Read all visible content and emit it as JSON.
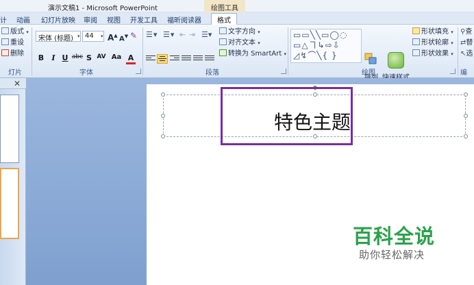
{
  "window": {
    "title": "演示文稿1 - Microsoft PowerPoint",
    "context_group": "绘图工具"
  },
  "tabs": [
    {
      "label": "计"
    },
    {
      "label": "动画"
    },
    {
      "label": "幻灯片放映"
    },
    {
      "label": "审阅"
    },
    {
      "label": "视图"
    },
    {
      "label": "开发工具"
    },
    {
      "label": "福昕阅读器"
    },
    {
      "label": "格式"
    }
  ],
  "ribbon": {
    "slides_group": {
      "label": "灯片",
      "layout": "版式",
      "reset": "重设",
      "delete": "删除"
    },
    "font_group": {
      "label": "字体",
      "font_name": "宋体 (标题)",
      "font_size": "44",
      "grow": "A",
      "shrink": "A",
      "bold": "B",
      "italic": "I",
      "underline": "U",
      "strike": "abc",
      "shadow": "S",
      "spacing": "AV",
      "case": "Aa",
      "color": "A"
    },
    "paragraph_group": {
      "label": "段落",
      "text_direction": "文字方向",
      "align_text": "对齐文本",
      "convert_smartart": "转换为 SmartArt"
    },
    "drawing_group": {
      "label": "绘图",
      "shapes_glyphs": "▭▭╲╲▭◯◌ ▭△ヿ↳⇨⇩ ◿↯⌒╲{ }",
      "arrange": "排列",
      "quick_styles": "快速样式",
      "shape_fill": "形状填充",
      "shape_outline": "形状轮廓",
      "shape_effects": "形状效果"
    },
    "edit_group": {
      "label": "编",
      "find": "查",
      "replace": "替",
      "select": "选"
    }
  },
  "slide": {
    "title_text": "特色主题"
  },
  "watermark": {
    "main": "百科全说",
    "sub": "助你轻松解决"
  },
  "colors": {
    "highlight": "#7a2d9c",
    "watermark_green": "#2aa24a",
    "workspace_blue": "#8aa9d6"
  }
}
